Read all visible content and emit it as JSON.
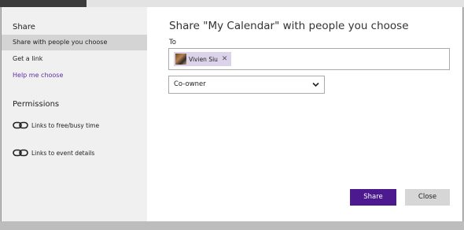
{
  "sidebar": {
    "share_heading": "Share",
    "items": [
      {
        "label": "Share with people you choose",
        "selected": true
      },
      {
        "label": "Get a link",
        "selected": false
      },
      {
        "label": "Help me choose",
        "selected": false
      }
    ],
    "permissions_heading": "Permissions",
    "permissions": [
      {
        "label": "Links to free/busy time",
        "icon": "link-icon"
      },
      {
        "label": "Links to event details",
        "icon": "link-icon"
      }
    ]
  },
  "main": {
    "title": "Share \"My Calendar\" with people you choose",
    "to_label": "To",
    "recipients": [
      {
        "name": "Vivien Siu"
      }
    ],
    "permission_level": "Co-owner"
  },
  "footer": {
    "share_label": "Share",
    "close_label": "Close"
  },
  "colors": {
    "accent": "#4c1a8e",
    "link": "#5e2ea2",
    "chip_bg": "#dcd2ea"
  }
}
